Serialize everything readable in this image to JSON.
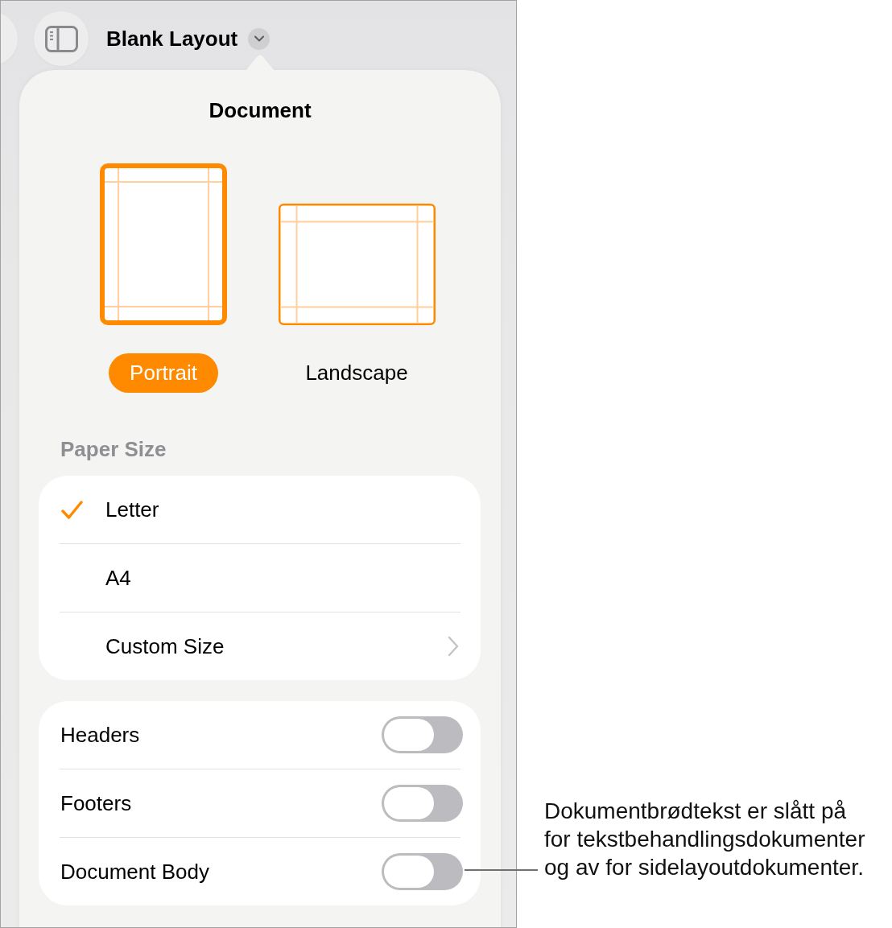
{
  "toolbar": {
    "title": "Blank Layout"
  },
  "popover": {
    "title": "Document",
    "orientations": [
      {
        "kind": "portrait",
        "label": "Portrait",
        "selected": true
      },
      {
        "kind": "landscape",
        "label": "Landscape",
        "selected": false
      }
    ],
    "paper_size": {
      "heading": "Paper Size",
      "options": [
        {
          "kind": "option",
          "label": "Letter",
          "selected": true
        },
        {
          "kind": "option",
          "label": "A4",
          "selected": false
        },
        {
          "kind": "submenu",
          "label": "Custom Size",
          "selected": false
        }
      ]
    },
    "toggles": [
      {
        "label": "Headers",
        "on": false
      },
      {
        "label": "Footers",
        "on": false
      },
      {
        "label": "Document Body",
        "on": false
      }
    ]
  },
  "callout": {
    "text": "Dokumentbrødtekst er slått på for tekstbehandlingsdokumenter og av for sidelayoutdokumenter."
  }
}
